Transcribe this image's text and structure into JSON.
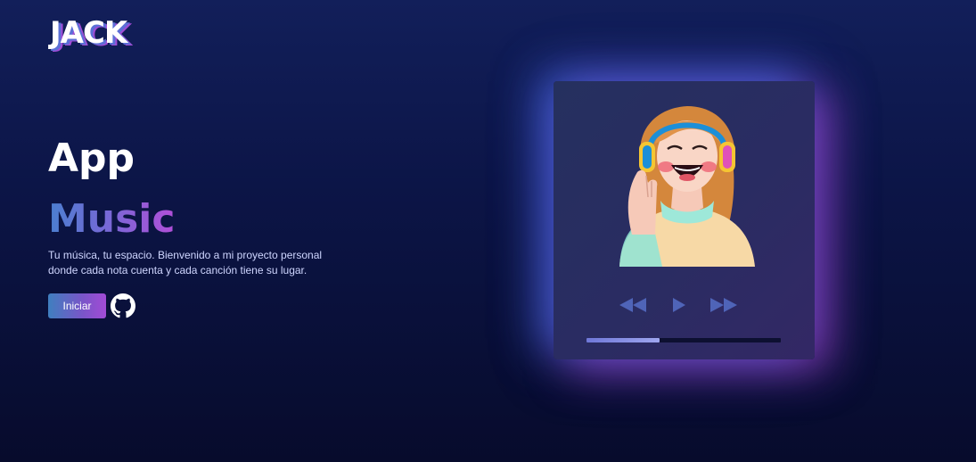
{
  "logo": {
    "text": "JACK"
  },
  "hero": {
    "title_line1": "App",
    "title_line2": "Music",
    "description": "Tu música, tu espacio. Bienvenido a mi proyecto personal donde cada nota cuenta y cada canción tiene su lugar.",
    "start_label": "Iniciar",
    "github_icon": "github-icon"
  },
  "player": {
    "cover_icon": "girl-with-headphones-illustration",
    "controls": [
      "rewind-icon",
      "play-icon",
      "fast-forward-icon"
    ],
    "progress": 0.375
  },
  "colors": {
    "background_top": "#121f5a",
    "background_bottom": "#070b2c",
    "accent_blue": "#4a7fd0",
    "accent_purple": "#b14fd8",
    "control_color": "#4f64b8"
  }
}
